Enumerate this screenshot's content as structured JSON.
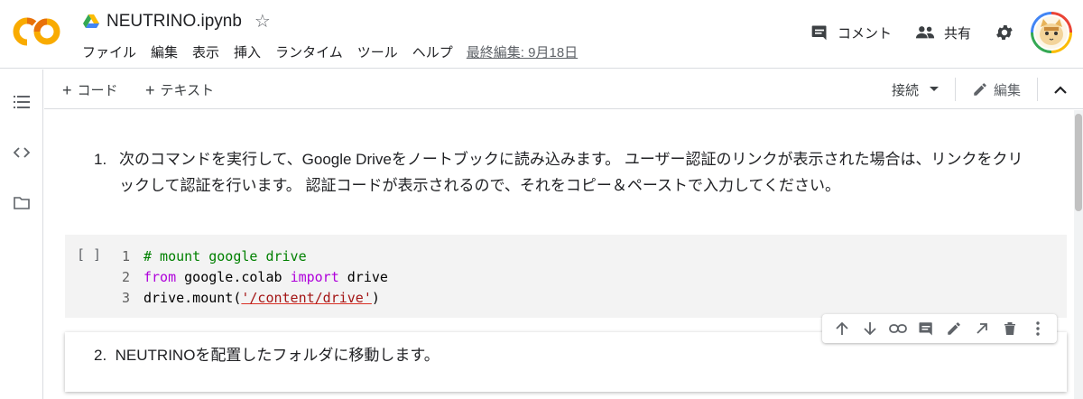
{
  "header": {
    "logo_text": "CO",
    "doc_title": "NEUTRINO.ipynb",
    "menu": [
      "ファイル",
      "編集",
      "表示",
      "挿入",
      "ランタイム",
      "ツール",
      "ヘルプ"
    ],
    "last_edit": "最終編集: 9月18日",
    "comment_label": "コメント",
    "share_label": "共有",
    "icons": {
      "drive": "drive-icon",
      "star": "star-icon",
      "comment": "comment-icon",
      "share": "people-icon",
      "settings": "gear-icon"
    }
  },
  "toolbar": {
    "add_code": "コード",
    "add_text": "テキスト",
    "connect": "接続",
    "edit": "編集"
  },
  "cells": {
    "text1": {
      "number": "1.",
      "text": "次のコマンドを実行して、Google Driveをノートブックに読み込みます。 ユーザー認証のリンクが表示された場合は、リンクをクリックして認証を行います。 認証コードが表示されるので、それをコピー＆ペーストで入力してください。"
    },
    "code1": {
      "run_bracket": "[ ]",
      "lines": [
        {
          "num": "1",
          "comment": "# mount google drive"
        },
        {
          "num": "2",
          "kw1": "from",
          "mod": " google.colab ",
          "kw2": "import",
          "rest": " drive"
        },
        {
          "num": "3",
          "pre": "drive.mount(",
          "str": "'/content/drive'",
          "post": ")"
        }
      ]
    },
    "text2": {
      "number": "2.",
      "text": "NEUTRINOを配置したフォルダに移動します。"
    }
  },
  "colors": {
    "logo_orange": "#f9ab00",
    "logo_dark_orange": "#e8710a",
    "comment_green": "#008000",
    "keyword_purple": "#af00db",
    "string_red": "#a31515"
  }
}
